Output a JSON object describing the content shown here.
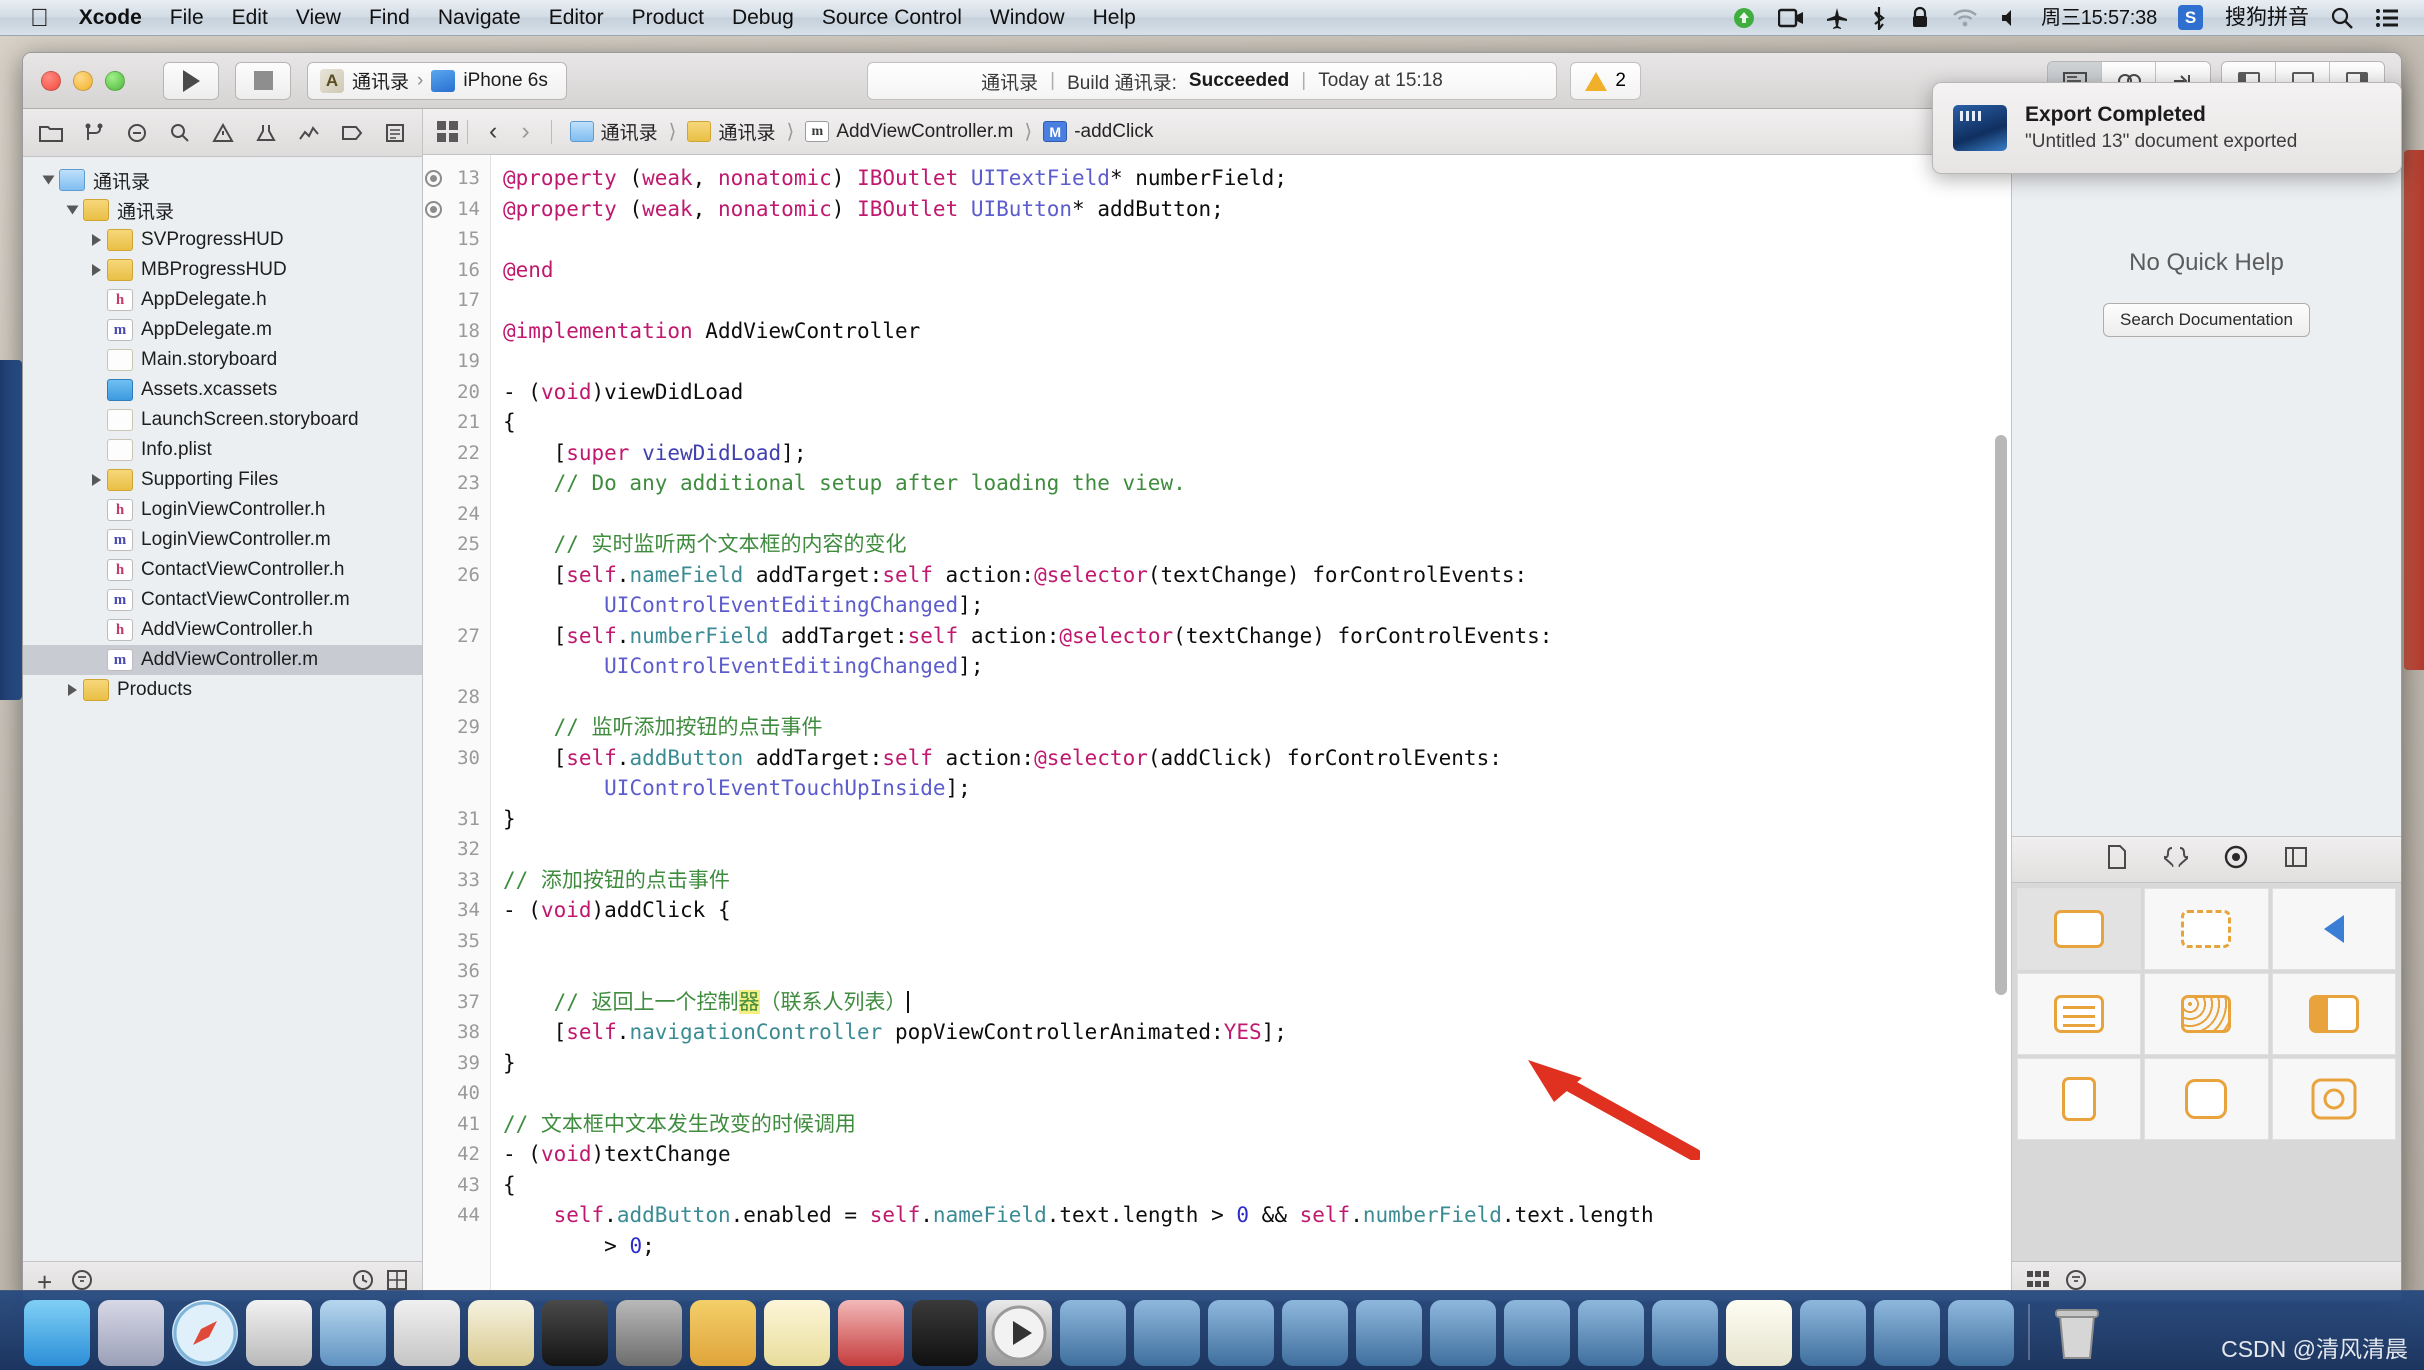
{
  "menubar": {
    "apple_icon": "apple-logo",
    "items": [
      "Xcode",
      "File",
      "Edit",
      "View",
      "Find",
      "Navigate",
      "Editor",
      "Product",
      "Debug",
      "Source Control",
      "Window",
      "Help"
    ],
    "status_icons": [
      "green-dot-icon",
      "screen-record-icon",
      "airplane-icon",
      "bluetooth-icon",
      "lock-icon",
      "wifi-icon",
      "volume-icon"
    ],
    "clock": "周三15:57:38",
    "ime_badge": "S",
    "ime_label": "搜狗拼音",
    "search_icon": "search-icon",
    "control_center_icon": "control-center-icon"
  },
  "toolbar": {
    "run_icon": "run-play-icon",
    "stop_icon": "stop-square-icon",
    "scheme_project": "通讯录",
    "scheme_separator": "›",
    "scheme_device": "iPhone 6s",
    "activity": {
      "project": "通讯录",
      "divider": "|",
      "build_label": "Build 通讯录:",
      "build_status": "Succeeded",
      "timestamp": "Today at 15:18"
    },
    "warning_count": "2",
    "editor_segments": [
      "standard-editor",
      "assistant-editor",
      "version-editor"
    ],
    "view_segments": [
      "navigator-toggle",
      "debug-toggle",
      "utilities-toggle"
    ]
  },
  "notification": {
    "icon": "export-document-icon",
    "title": "Export Completed",
    "subtitle": "\"Untitled 13\" document exported"
  },
  "navigator": {
    "tabs": [
      "project-navigator",
      "source-control-navigator",
      "symbol-navigator",
      "find-navigator",
      "issue-navigator",
      "test-navigator",
      "debug-navigator",
      "breakpoint-navigator",
      "report-navigator"
    ],
    "tree": [
      {
        "label": "通讯录",
        "kind": "proj",
        "indent": 0,
        "twisty": "open",
        "selected": false
      },
      {
        "label": "通讯录",
        "kind": "folder",
        "indent": 1,
        "twisty": "open",
        "selected": false
      },
      {
        "label": "SVProgressHUD",
        "kind": "folder",
        "indent": 2,
        "twisty": "closed",
        "selected": false
      },
      {
        "label": "MBProgressHUD",
        "kind": "folder",
        "indent": 2,
        "twisty": "closed",
        "selected": false
      },
      {
        "label": "AppDelegate.h",
        "kind": "h",
        "indent": 2,
        "twisty": "none",
        "selected": false
      },
      {
        "label": "AppDelegate.m",
        "kind": "m",
        "indent": 2,
        "twisty": "none",
        "selected": false
      },
      {
        "label": "Main.storyboard",
        "kind": "sb",
        "indent": 2,
        "twisty": "none",
        "selected": false
      },
      {
        "label": "Assets.xcassets",
        "kind": "xcassets",
        "indent": 2,
        "twisty": "none",
        "selected": false
      },
      {
        "label": "LaunchScreen.storyboard",
        "kind": "sb",
        "indent": 2,
        "twisty": "none",
        "selected": false
      },
      {
        "label": "Info.plist",
        "kind": "plist",
        "indent": 2,
        "twisty": "none",
        "selected": false
      },
      {
        "label": "Supporting Files",
        "kind": "folder",
        "indent": 2,
        "twisty": "closed",
        "selected": false
      },
      {
        "label": "LoginViewController.h",
        "kind": "h",
        "indent": 2,
        "twisty": "none",
        "selected": false
      },
      {
        "label": "LoginViewController.m",
        "kind": "m",
        "indent": 2,
        "twisty": "none",
        "selected": false
      },
      {
        "label": "ContactViewController.h",
        "kind": "h",
        "indent": 2,
        "twisty": "none",
        "selected": false
      },
      {
        "label": "ContactViewController.m",
        "kind": "m",
        "indent": 2,
        "twisty": "none",
        "selected": false
      },
      {
        "label": "AddViewController.h",
        "kind": "h",
        "indent": 2,
        "twisty": "none",
        "selected": false
      },
      {
        "label": "AddViewController.m",
        "kind": "m",
        "indent": 2,
        "twisty": "none",
        "selected": true
      },
      {
        "label": "Products",
        "kind": "folder",
        "indent": 1,
        "twisty": "closed",
        "selected": false
      }
    ],
    "footer": {
      "add_icon": "plus-icon",
      "filter_icon": "filter-icon",
      "recent_icon": "clock-icon",
      "source_icon": "source-control-icon"
    }
  },
  "jumpbar": {
    "grid_icon": "related-items-icon",
    "back_icon": "back-chevron-icon",
    "forward_icon": "forward-chevron-icon",
    "crumbs": [
      {
        "label": "通讯录",
        "icon": "project-icon"
      },
      {
        "label": "通讯录",
        "icon": "folder-icon"
      },
      {
        "label": "AddViewController.m",
        "icon": "m-file-icon"
      },
      {
        "label": "-addClick",
        "icon": "method-marker-icon"
      }
    ]
  },
  "editor": {
    "first_line": 13,
    "lines": [
      {
        "n": "13",
        "bp": true,
        "html": "<span class='kw'>@property</span> (<span class='kw'>weak</span>, <span class='kw'>nonatomic</span>) <span class='kw'>IBOutlet</span> <span class='ty'>UITextField</span>* numberField;"
      },
      {
        "n": "14",
        "bp": true,
        "html": "<span class='kw'>@property</span> (<span class='kw'>weak</span>, <span class='kw'>nonatomic</span>) <span class='kw'>IBOutlet</span> <span class='ty'>UIButton</span>* addButton;"
      },
      {
        "n": "15",
        "bp": false,
        "html": ""
      },
      {
        "n": "16",
        "bp": false,
        "html": "<span class='kw'>@end</span>"
      },
      {
        "n": "17",
        "bp": false,
        "html": ""
      },
      {
        "n": "18",
        "bp": false,
        "html": "<span class='kw'>@implementation</span> AddViewController"
      },
      {
        "n": "19",
        "bp": false,
        "html": ""
      },
      {
        "n": "20",
        "bp": false,
        "html": "- (<span class='kw'>void</span>)viewDidLoad"
      },
      {
        "n": "21",
        "bp": false,
        "html": "{"
      },
      {
        "n": "22",
        "bp": false,
        "html": "    [<span class='kw'>super</span> <span class='pr'>viewDidLoad</span>];"
      },
      {
        "n": "23",
        "bp": false,
        "html": "    <span class='cm'>// Do any additional setup after loading the view.</span>"
      },
      {
        "n": "24",
        "bp": false,
        "html": ""
      },
      {
        "n": "25",
        "bp": false,
        "html": "    <span class='cm'>// 实时监听两个文本框的内容的变化</span>"
      },
      {
        "n": "26",
        "bp": false,
        "html": "    [<span class='kw'>self</span>.<span class='ivar'>nameField</span> addTarget:<span class='kw'>self</span> action:<span class='kw'>@selector</span>(textChange) forControlEvents:"
      },
      {
        "n": "",
        "bp": false,
        "html": "        <span class='ty'>UIControlEventEditingChanged</span>];"
      },
      {
        "n": "27",
        "bp": false,
        "html": "    [<span class='kw'>self</span>.<span class='ivar'>numberField</span> addTarget:<span class='kw'>self</span> action:<span class='kw'>@selector</span>(textChange) forControlEvents:"
      },
      {
        "n": "",
        "bp": false,
        "html": "        <span class='ty'>UIControlEventEditingChanged</span>];"
      },
      {
        "n": "28",
        "bp": false,
        "html": ""
      },
      {
        "n": "29",
        "bp": false,
        "html": "    <span class='cm'>// 监听添加按钮的点击事件</span>"
      },
      {
        "n": "30",
        "bp": false,
        "html": "    [<span class='kw'>self</span>.<span class='ivar'>addButton</span> addTarget:<span class='kw'>self</span> action:<span class='kw'>@selector</span>(addClick) forControlEvents:"
      },
      {
        "n": "",
        "bp": false,
        "html": "        <span class='ty'>UIControlEventTouchUpInside</span>];"
      },
      {
        "n": "31",
        "bp": false,
        "html": "}"
      },
      {
        "n": "32",
        "bp": false,
        "html": ""
      },
      {
        "n": "33",
        "bp": false,
        "html": "<span class='cm'>// 添加按钮的点击事件</span>"
      },
      {
        "n": "34",
        "bp": false,
        "html": "- (<span class='kw'>void</span>)addClick {"
      },
      {
        "n": "35",
        "bp": false,
        "html": ""
      },
      {
        "n": "36",
        "bp": false,
        "html": ""
      },
      {
        "n": "37",
        "bp": false,
        "html": "    <span class='cm'>// 返回上一个控制<span class='hl'>器</span>（联系人列表）</span><span class='caret'></span>"
      },
      {
        "n": "38",
        "bp": false,
        "html": "    [<span class='kw'>self</span>.<span class='ivar'>navigationController</span> popViewControllerAnimated:<span class='kw'>YES</span>];"
      },
      {
        "n": "39",
        "bp": false,
        "html": "}"
      },
      {
        "n": "40",
        "bp": false,
        "html": ""
      },
      {
        "n": "41",
        "bp": false,
        "html": "<span class='cm'>// 文本框中文本发生改变的时候调用</span>"
      },
      {
        "n": "42",
        "bp": false,
        "html": "- (<span class='kw'>void</span>)textChange"
      },
      {
        "n": "43",
        "bp": false,
        "html": "{"
      },
      {
        "n": "44",
        "bp": false,
        "html": "    <span class='kw'>self</span>.<span class='ivar'>addButton</span>.enabled = <span class='kw'>self</span>.<span class='ivar'>nameField</span>.text.length &gt; <span class='num'>0</span> &amp;&amp; <span class='kw'>self</span>.<span class='ivar'>numberField</span>.text.length"
      },
      {
        "n": "",
        "bp": false,
        "html": "        &gt; <span class='num'>0</span>;"
      }
    ]
  },
  "utilities": {
    "tabs": [
      "file-inspector",
      "quick-help-inspector"
    ],
    "quick_help_title": "No Quick Help",
    "search_documentation_label": "Search Documentation",
    "library_tabs": [
      "file-template-library",
      "code-snippet-library",
      "object-library",
      "media-library"
    ],
    "library_items": [
      "rounded-rect-object",
      "dashed-rect-object",
      "back-chevron-object",
      "list-lines-object",
      "grid-dots-object",
      "split-panel-object",
      "tall-rect-object",
      "rounded-square-object",
      "circle-target-object"
    ],
    "footer_icons": [
      "grid-view-icon",
      "filter-icon"
    ]
  },
  "dock": {
    "items": [
      "finder-icon",
      "launchpad-icon",
      "safari-icon",
      "mouse-icon",
      "photos-icon",
      "tools-icon",
      "notes-pen-icon",
      "terminal-icon",
      "settings-gear-icon",
      "sketch-icon",
      "notes-icon",
      "pinyin-icon",
      "mac-icon",
      "quicktime-icon",
      "screen1-icon",
      "screen2-icon",
      "screen3-icon",
      "screen4-icon",
      "screen5-icon",
      "screen6-icon",
      "screen7-icon",
      "screen8-icon",
      "screen9-icon",
      "document-icon",
      "screen10-icon",
      "screen11-icon",
      "screen12-icon"
    ],
    "trash": "trash-icon"
  },
  "watermark": "CSDN @清风清晨"
}
